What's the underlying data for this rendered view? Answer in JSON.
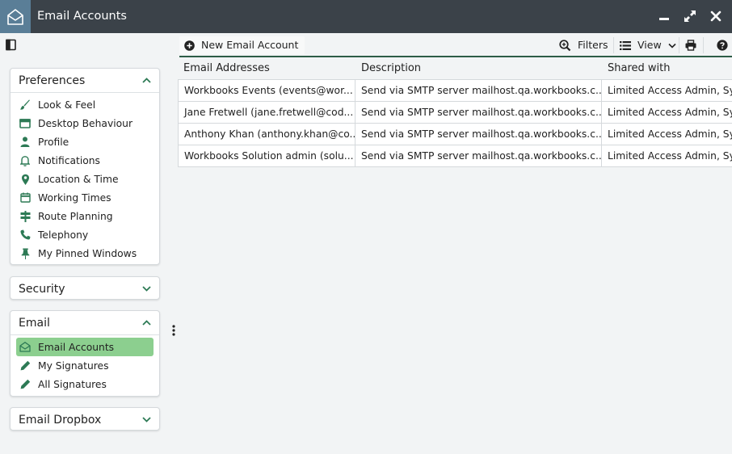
{
  "window": {
    "title": "Email Accounts",
    "icons": {
      "app": "envelope-open-icon",
      "minimize": "minimize-icon",
      "maximize": "maximize-icon",
      "close": "close-icon"
    }
  },
  "toolbar": {
    "new_label": "New Email Account",
    "filters_label": "Filters",
    "view_label": "View"
  },
  "sidebar": {
    "preferences": {
      "title": "Preferences",
      "items": [
        {
          "label": "Look & Feel",
          "icon": "brush-icon"
        },
        {
          "label": "Desktop Behaviour",
          "icon": "window-icon"
        },
        {
          "label": "Profile",
          "icon": "user-icon"
        },
        {
          "label": "Notifications",
          "icon": "bell-icon"
        },
        {
          "label": "Location & Time",
          "icon": "map-pin-icon"
        },
        {
          "label": "Working Times",
          "icon": "calendar-icon"
        },
        {
          "label": "Route Planning",
          "icon": "signpost-icon"
        },
        {
          "label": "Telephony",
          "icon": "phone-icon"
        },
        {
          "label": "My Pinned Windows",
          "icon": "pin-icon"
        }
      ]
    },
    "security": {
      "title": "Security"
    },
    "email": {
      "title": "Email",
      "items": [
        {
          "label": "Email Accounts",
          "icon": "envelope-open-icon",
          "active": true
        },
        {
          "label": "My Signatures",
          "icon": "pencil-icon"
        },
        {
          "label": "All Signatures",
          "icon": "pencil-icon"
        }
      ]
    },
    "dropbox": {
      "title": "Email Dropbox"
    }
  },
  "table": {
    "columns": [
      "Email Addresses",
      "Description",
      "Shared with"
    ],
    "rows": [
      [
        "Workbooks Events (events@wor...",
        "Send via SMTP server mailhost.qa.workbooks.c...",
        "Limited Access Admin, Sys"
      ],
      [
        "Jane Fretwell (jane.fretwell@cod...",
        "Send via SMTP server mailhost.qa.workbooks.c...",
        "Limited Access Admin, Sys"
      ],
      [
        "Anthony Khan (anthony.khan@co...",
        "Send via SMTP server mailhost.qa.workbooks.c...",
        "Limited Access Admin, Sys"
      ],
      [
        "Workbooks Solution admin (solu...",
        "Send via SMTP server mailhost.qa.workbooks.c...",
        "Limited Access Admin, Sys"
      ]
    ]
  },
  "colors": {
    "titlebar": "#3b4249",
    "app_icon_bg": "#5a7e97",
    "accent_green": "#2d7a55",
    "active_item": "#8ccf8f"
  }
}
